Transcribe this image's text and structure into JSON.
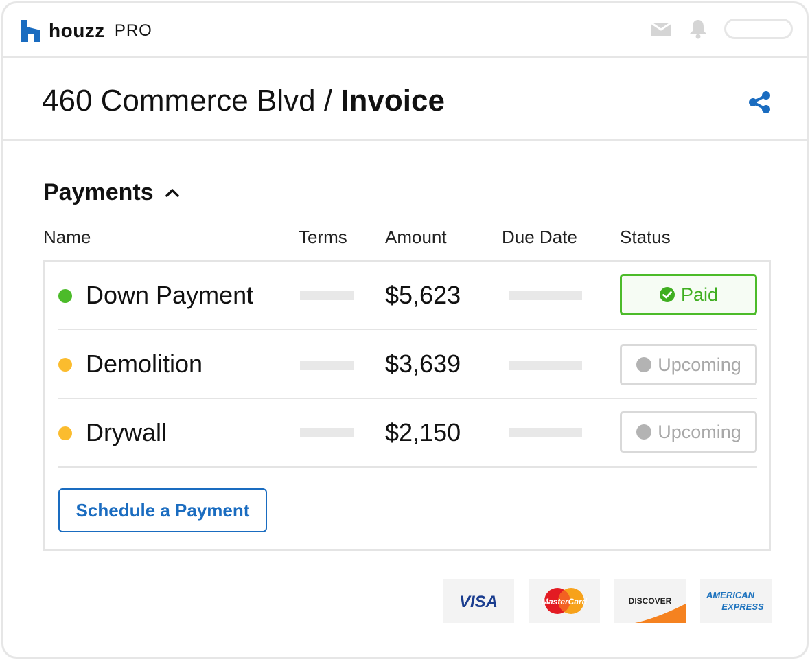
{
  "app": {
    "logo_text": "houzz",
    "logo_suffix": "PRO",
    "icons": [
      "inbox-icon",
      "bell-icon"
    ]
  },
  "header": {
    "breadcrumb_project": "460 Commerce Blvd",
    "breadcrumb_separator": "/",
    "breadcrumb_page": "Invoice",
    "share_icon": "share-icon"
  },
  "payments": {
    "title": "Payments",
    "columns": [
      "Name",
      "Terms",
      "Amount",
      "Due Date",
      "Status"
    ],
    "rows": [
      {
        "name": "Down Payment",
        "amount": "$5,623",
        "status": "Paid",
        "dot_color": "#4cbb2a"
      },
      {
        "name": "Demolition",
        "amount": "$3,639",
        "status": "Upcoming",
        "dot_color": "#fbbc2e"
      },
      {
        "name": "Drywall",
        "amount": "$2,150",
        "status": "Upcoming",
        "dot_color": "#fbbc2e"
      }
    ],
    "schedule_label": "Schedule a Payment"
  },
  "cards": {
    "visa": "VISA",
    "mastercard": "MasterCard",
    "discover": "DISCOVER",
    "amex_line1": "AMERICAN",
    "amex_line2": "EXPRESS"
  },
  "colors": {
    "accent_blue": "#1a6cc0",
    "paid_green": "#4cbb2a",
    "upcoming_yellow": "#fbbc2e",
    "border_gray": "#e6e6e6"
  }
}
